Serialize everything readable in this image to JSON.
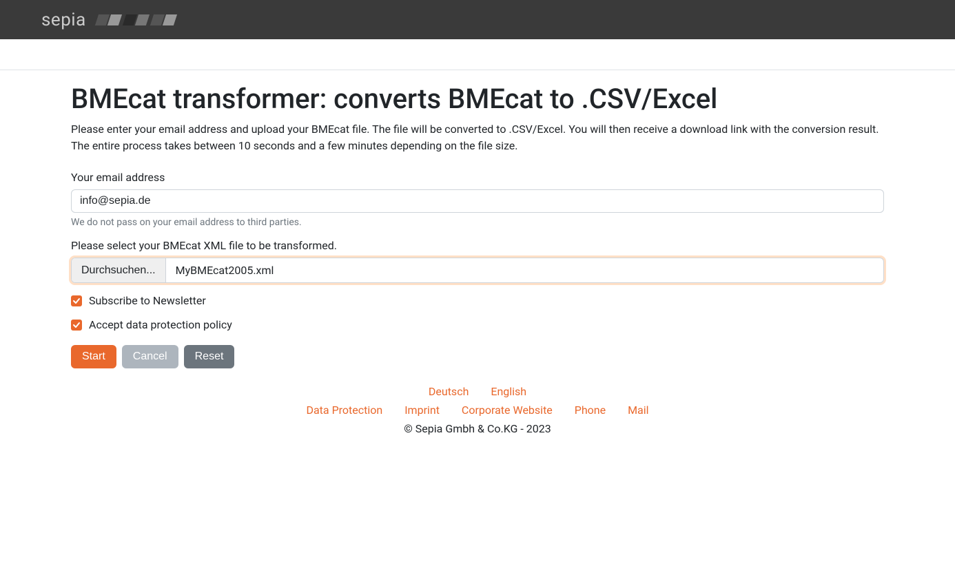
{
  "header": {
    "logo_text": "sepia"
  },
  "main": {
    "title": "BMEcat transformer: converts BMEcat to .CSV/Excel",
    "description": "Please enter your email address and upload your BMEcat file. The file will be converted to .CSV/Excel. You will then receive a download link with the conversion result. The entire process takes between 10 seconds and a few minutes depending on the file size.",
    "email": {
      "label": "Your email address",
      "value": "info@sepia.de",
      "help": "We do not pass on your email address to third parties."
    },
    "file": {
      "label": "Please select your BMEcat XML file to be transformed.",
      "browse_label": "Durchsuchen...",
      "filename": "MyBMEcat2005.xml"
    },
    "checks": {
      "newsletter": "Subscribe to Newsletter",
      "privacy": "Accept data protection policy"
    },
    "buttons": {
      "start": "Start",
      "cancel": "Cancel",
      "reset": "Reset"
    }
  },
  "footer": {
    "langs": {
      "de": "Deutsch",
      "en": "English"
    },
    "links": {
      "data_protection": "Data Protection",
      "imprint": "Imprint",
      "corporate": "Corporate Website",
      "phone": "Phone",
      "mail": "Mail"
    },
    "copyright": "© Sepia Gmbh & Co.KG - 2023"
  }
}
